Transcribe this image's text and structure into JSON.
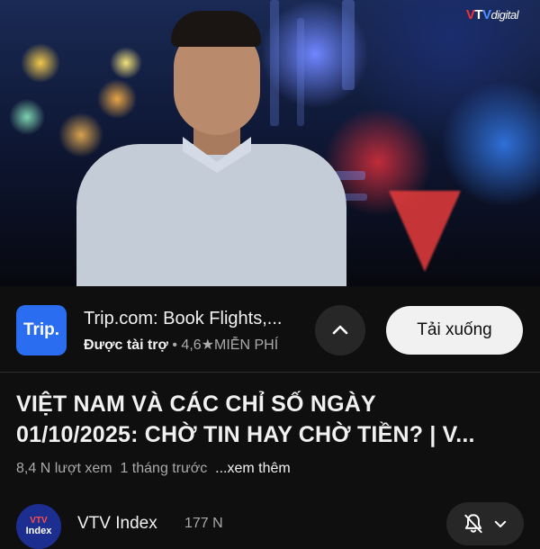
{
  "video": {
    "logo": {
      "v1": "V",
      "t": "T",
      "v2": "V",
      "suffix": "digital"
    }
  },
  "ad": {
    "logo_text": "Trip.",
    "title": "Trip.com: Book Flights,...",
    "sponsored_label": "Được tài trợ",
    "separator": "•",
    "rating": "4,6",
    "star": "★",
    "price": "MIỄN PHÍ",
    "download_label": "Tải xuống",
    "accent_color": "#2a6df0"
  },
  "video_info": {
    "title_line1": "VIỆT NAM VÀ CÁC CHỈ SỐ NGÀY",
    "title_line2": "01/10/2025: CHỜ TIN HAY CHỜ TIỀN? | V...",
    "views": "8,4 N lượt xem",
    "age": "1 tháng trước",
    "more": "...xem thêm"
  },
  "channel": {
    "avatar_top": "VTV",
    "avatar_bottom": "Index",
    "name": "VTV Index",
    "subscribers": "177 N",
    "bell_icon": "bell-off-icon",
    "dropdown_icon": "chevron-down-icon"
  }
}
